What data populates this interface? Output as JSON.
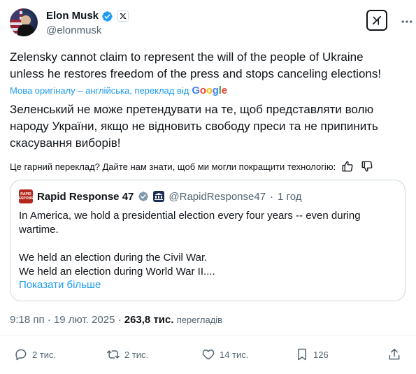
{
  "author": {
    "name": "Elon Musk",
    "handle": "@elonmusk",
    "verified_icon": "verified-badge-icon",
    "affiliate_icon": "x-logo-icon"
  },
  "header_actions": {
    "grok_icon": "grok-icon",
    "more_icon": "more-dots-icon"
  },
  "tweet": {
    "text": "Zelensky cannot claim to represent the will of the people of Ukraine\nunless he restores freedom of the press and stops canceling elections!",
    "translate_label": "Мова оригіналу – англійська, переклад від",
    "translate_provider": "Google",
    "translated_text": "Зеленський не може претендувати на те, щоб представляти волю\nнароду України, якщо не відновить свободу преси та не припинить\nскасування виборів!",
    "feedback_prompt": "Це гарний переклад? Дайте нам знати, щоб ми могли покращити технологію:"
  },
  "quote": {
    "avatar_text": "RAPID RESPONSE",
    "name": "Rapid Response 47",
    "handle": "@RapidResponse47",
    "separator": "·",
    "time": "1 год",
    "text": "In America, we hold a presidential election every four years -- even during\nwartime.\n\nWe held an election during the Civil War.\nWe held an election during World War II....",
    "show_more": "Показати більше"
  },
  "meta": {
    "time": "9:18 пп",
    "sep1": "·",
    "date": "19 лют. 2025",
    "sep2": "·",
    "views_count": "263,8 тис.",
    "views_label": "перегладів"
  },
  "actions": {
    "replies": "2 тис.",
    "reposts": "2 тис.",
    "likes": "14 тис.",
    "bookmarks": "126"
  },
  "colors": {
    "accent": "#1d9bf0",
    "text": "#0f1419",
    "muted": "#536471",
    "border": "#cfd9de"
  }
}
